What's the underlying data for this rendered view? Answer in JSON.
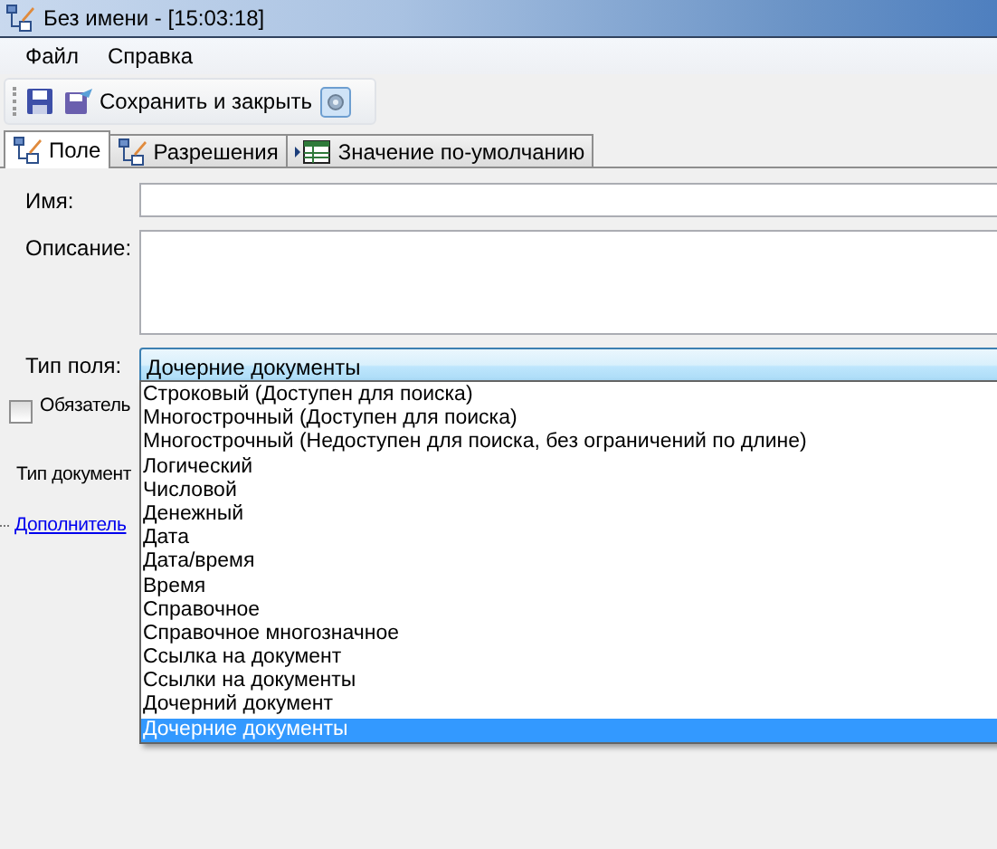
{
  "window": {
    "title": "Без имени - [15:03:18]"
  },
  "menu": [
    "Файл",
    "Справка"
  ],
  "toolbar": {
    "save_close": "Сохранить и закрыть"
  },
  "tabs": [
    {
      "label": "Поле",
      "selected": true,
      "kind": "field"
    },
    {
      "label": "Разрешения",
      "selected": false,
      "kind": "field"
    },
    {
      "label": "Значение по-умолчанию",
      "selected": false,
      "kind": "table"
    }
  ],
  "form": {
    "name_label": "Имя:",
    "description_label": "Описание:",
    "field_type_label": "Тип поля:",
    "field_type_value": "Дочерние документы",
    "required": {
      "label": "Обязатель",
      "checked": false
    },
    "doc_type_label": "Тип документ",
    "more_link": "Дополнитель"
  },
  "dropdown": {
    "options": [
      {
        "label": "Строковый (Доступен для поиска)",
        "selected": false
      },
      {
        "label": "Многострочный (Доступен для поиска)",
        "selected": false
      },
      {
        "label": "Многострочный (Недоступен для поиска, без ограничений по длине)",
        "selected": false
      },
      {
        "label": "Логический",
        "selected": false
      },
      {
        "label": "Числовой",
        "selected": false
      },
      {
        "label": "Денежный",
        "selected": false
      },
      {
        "label": "Дата",
        "selected": false
      },
      {
        "label": "Дата/время",
        "selected": false
      },
      {
        "label": "Время",
        "selected": false
      },
      {
        "label": "Справочное",
        "selected": false
      },
      {
        "label": "Справочное многозначное",
        "selected": false
      },
      {
        "label": "Ссылка на документ",
        "selected": false
      },
      {
        "label": "Ссылки на документы",
        "selected": false
      },
      {
        "label": "Дочерний документ",
        "selected": false
      },
      {
        "label": "Дочерние документы",
        "selected": true
      }
    ]
  }
}
